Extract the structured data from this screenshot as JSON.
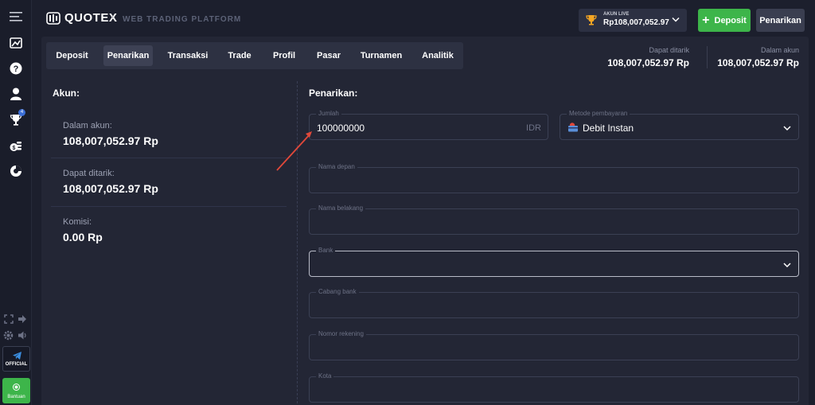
{
  "header": {
    "brand": "QUOTEX",
    "platform_label": "WEB TRADING PLATFORM",
    "account_type": "AKUN LIVE",
    "account_balance": "Rp108,007,052.97",
    "deposit_label": "Deposit",
    "withdraw_label": "Penarikan"
  },
  "sidebar": {
    "icons": [
      "menu-icon",
      "chart-icon",
      "help-icon",
      "user-icon",
      "trophy-icon",
      "coins-icon",
      "analytics-icon"
    ],
    "trophy_badge": "4",
    "official_label": "OFFICIAL",
    "help_label": "Bantuan"
  },
  "tabs": [
    {
      "label": "Deposit"
    },
    {
      "label": "Penarikan"
    },
    {
      "label": "Transaksi"
    },
    {
      "label": "Trade"
    },
    {
      "label": "Profil"
    },
    {
      "label": "Pasar"
    },
    {
      "label": "Turnamen"
    },
    {
      "label": "Analitik"
    }
  ],
  "active_tab": "Penarikan",
  "summary": {
    "withdrawable_label": "Dapat ditarik",
    "withdrawable_value": "108,007,052.97 Rp",
    "in_account_label": "Dalam akun",
    "in_account_value": "108,007,052.97 Rp"
  },
  "account": {
    "title": "Akun:",
    "in_account_label": "Dalam akun:",
    "in_account_value": "108,007,052.97 Rp",
    "withdrawable_label": "Dapat ditarik:",
    "withdrawable_value": "108,007,052.97 Rp",
    "commission_label": "Komisi:",
    "commission_value": "0.00 Rp"
  },
  "withdraw_form": {
    "title": "Penarikan:",
    "amount_label": "Jumlah",
    "amount_value": "100000000",
    "currency": "IDR",
    "method_label": "Metode pembayaran",
    "method_value": "Debit Instan",
    "first_name_label": "Nama depan",
    "last_name_label": "Nama belakang",
    "bank_label": "Bank",
    "branch_label": "Cabang bank",
    "account_number_label": "Nomor rekening",
    "city_label": "Kota"
  },
  "colors": {
    "accent_green": "#3db54a",
    "background": "#1c1f2d",
    "panel": "#232635",
    "annotation_arrow": "#e0483a"
  }
}
